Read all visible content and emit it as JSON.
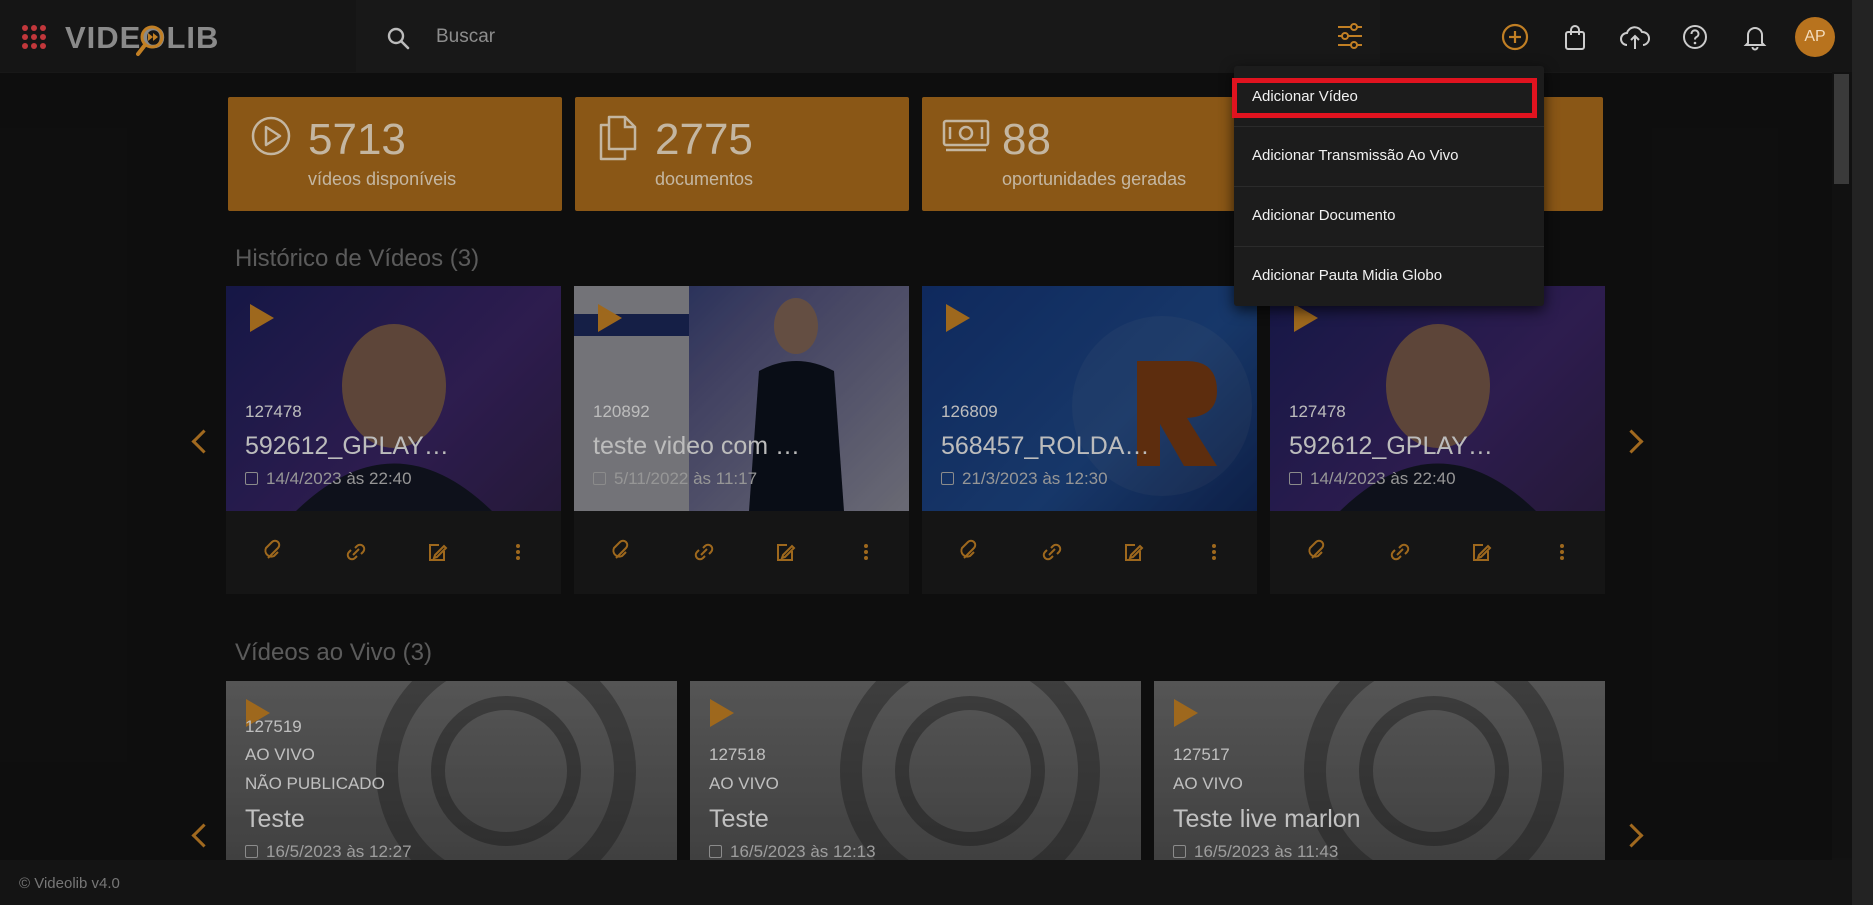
{
  "app": {
    "logo": "VIDEOLIB"
  },
  "search": {
    "placeholder": "Buscar"
  },
  "header": {
    "avatar_initials": "AP"
  },
  "colors": {
    "accent": "#a96b1b",
    "highlight": "#e0131f",
    "apps_icon": "#c2373b"
  },
  "stats": [
    {
      "value": "5713",
      "label": "vídeos disponíveis",
      "icon": "play-circle-icon"
    },
    {
      "value": "2775",
      "label": "documentos",
      "icon": "documents-icon"
    },
    {
      "value": "88",
      "label": "oportunidades geradas",
      "icon": "money-icon"
    }
  ],
  "history": {
    "title": "Histórico de Vídeos (3)",
    "cards": [
      {
        "id": "127478",
        "title": "592612_GPLAY…",
        "date": "14/4/2023 às 22:40"
      },
      {
        "id": "120892",
        "title": "teste video com …",
        "date": "5/11/2022 às 11:17"
      },
      {
        "id": "126809",
        "title": "568457_ROLDA…",
        "date": "21/3/2023 às 12:30"
      },
      {
        "id": "127478",
        "title": "592612_GPLAY…",
        "date": "14/4/2023 às 22:40"
      }
    ]
  },
  "live": {
    "title": "Vídeos ao Vivo (3)",
    "cards": [
      {
        "id": "127519",
        "status": "AO VIVO",
        "publish": "NÃO PUBLICADO",
        "title": "Teste",
        "date": "16/5/2023 às 12:27"
      },
      {
        "id": "127518",
        "status": "AO VIVO",
        "title": "Teste",
        "date": "16/5/2023 às 12:13"
      },
      {
        "id": "127517",
        "status": "AO VIVO",
        "title": "Teste live marlon",
        "date": "16/5/2023 às 11:43"
      }
    ]
  },
  "dropdown": {
    "items": [
      "Adicionar Vídeo",
      "Adicionar Transmissão Ao Vivo",
      "Adicionar Documento",
      "Adicionar Pauta Midia Globo"
    ]
  },
  "footer": {
    "text": "© Videolib v4.0"
  }
}
